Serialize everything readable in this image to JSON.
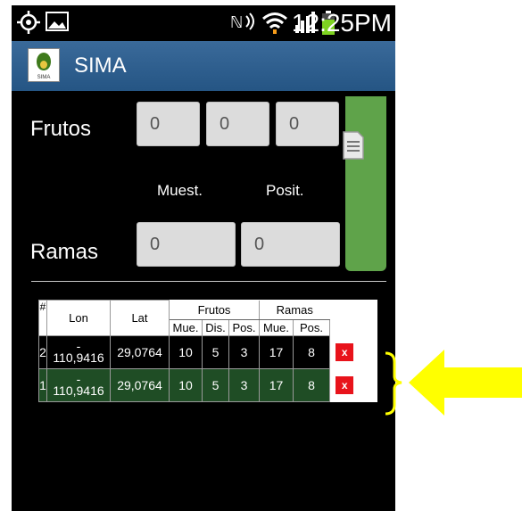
{
  "status_bar": {
    "time": "12:25PM"
  },
  "app": {
    "title": "SIMA",
    "logo_text": "SIMA"
  },
  "form": {
    "frutos_label": "Frutos",
    "frutos_values": [
      "0",
      "0",
      "0"
    ],
    "muest_label": "Muest.",
    "posit_label": "Posit.",
    "ramas_label": "Ramas",
    "ramas_values": [
      "0",
      "0"
    ],
    "save_icon": "document-icon"
  },
  "table": {
    "headers": {
      "num": "#",
      "lon": "Lon",
      "lat": "Lat",
      "frutos": "Frutos",
      "ramas": "Ramas",
      "frutos_mue": "Mue.",
      "frutos_dis": "Dis.",
      "frutos_pos": "Pos.",
      "ramas_mue": "Mue.",
      "ramas_pos": "Pos."
    },
    "rows": [
      {
        "num": "2",
        "lon_sign": "-",
        "lon": "110,9416",
        "lat": "29,0764",
        "f_mue": "10",
        "f_dis": "5",
        "f_pos": "3",
        "r_mue": "17",
        "r_pos": "8",
        "delete": "x"
      },
      {
        "num": "1",
        "lon_sign": "-",
        "lon": "110,9416",
        "lat": "29,0764",
        "f_mue": "10",
        "f_dis": "5",
        "f_pos": "3",
        "r_mue": "17",
        "r_pos": "8",
        "delete": "x"
      }
    ]
  },
  "colors": {
    "action_bar": "#2b5a8a",
    "save_button": "#5fa34a",
    "row_selected": "#1f4d25",
    "delete": "#e8131b",
    "annotation": "#ffff00"
  }
}
